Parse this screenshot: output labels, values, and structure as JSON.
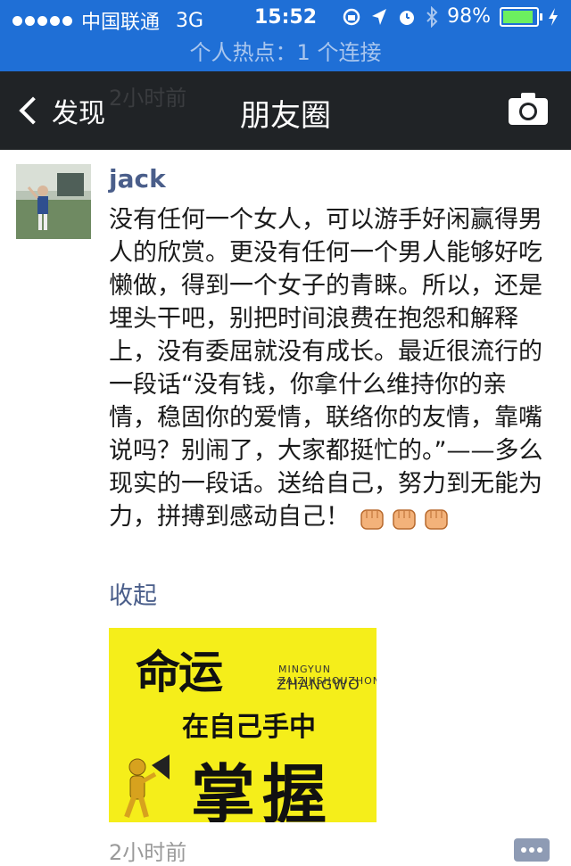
{
  "status_bar": {
    "carrier": "中国联通",
    "network": "3G",
    "time": "15:52",
    "battery_percent": "98%",
    "battery_level": 0.98,
    "icons": [
      "signal-dots-icon",
      "rotation-lock-icon",
      "location-arrow-icon",
      "alarm-icon",
      "bluetooth-icon",
      "battery-icon",
      "charging-icon"
    ]
  },
  "hotspot": {
    "text": "个人热点：1 个连接"
  },
  "nav": {
    "back_label": "发现",
    "title": "朋友圈",
    "ghost_time": "2小时前",
    "right_icon": "camera-icon"
  },
  "post": {
    "user_name": "jack",
    "text": "没有任何一个女人，可以游手好闲赢得男人的欣赏。更没有任何一个男人能够好吃懒做，得到一个女子的青睐。所以，还是埋头干吧，别把时间浪费在抱怨和解释上，没有委屈就没有成长。最近很流行的一段话“没有钱，你拿什么维持你的亲情，稳固你的爱情，联络你的友情，靠嘴说吗？别闹了，大家都挺忙的。”——多么现实的一段话。送给自己，努力到无能为力，拼搏到感动自己！",
    "emoji": [
      "fist-icon",
      "fist-icon",
      "fist-icon"
    ],
    "collapse_label": "收起",
    "image": {
      "line1": "命运",
      "small1": "MINGYUN ZAIZIJISHOUZHONG",
      "small2": "ZHANGWO",
      "line2": "在自己手中",
      "line3": "掌握",
      "background": "#f5ee1a"
    },
    "time": "2小时前"
  },
  "colors": {
    "status_bar_bg": "#1f6fd6",
    "nav_bg": "#202326",
    "name_color": "#4a5e8a"
  }
}
